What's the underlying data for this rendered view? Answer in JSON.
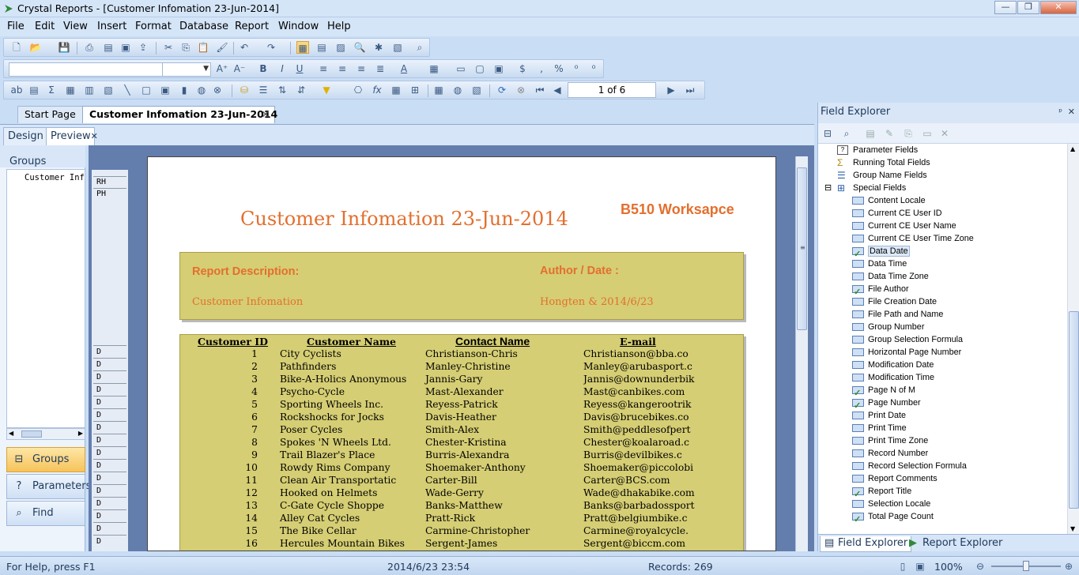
{
  "window": {
    "title": "Crystal Reports - [Customer Infomation 23-Jun-2014]",
    "minimize_label": "—",
    "restore_label": "❐",
    "close_label": "✕"
  },
  "menu": [
    "File",
    "Edit",
    "View",
    "Insert",
    "Format",
    "Database",
    "Report",
    "Window",
    "Help"
  ],
  "navigation": {
    "page_indicator": "1 of 6"
  },
  "document_tabs": {
    "start_page": "Start Page",
    "active": "Customer Infomation 23-Jun-2014",
    "close_glyph": "✕"
  },
  "view_tabs": {
    "design": "Design",
    "preview": "Preview",
    "close_glyph": "✕"
  },
  "left_panel": {
    "groups_header": "Groups",
    "tree_item": "Customer Info",
    "nav_buttons": {
      "groups": "Groups",
      "parameters": "Parameters",
      "find": "Find"
    }
  },
  "sections": {
    "rh": "RH",
    "ph": "PH",
    "detail": "D"
  },
  "report": {
    "title": "Customer Infomation 23-Jun-2014",
    "workspace": "B510 Worksapce",
    "description_label": "Report Description:",
    "author_label": "Author / Date :",
    "description_value": "Customer Infomation",
    "author_value": "Hongten & 2014/6/23",
    "columns": [
      "Customer ID",
      "Customer Name",
      "Contact Name",
      "E-mail"
    ],
    "rows": [
      [
        "1",
        "City Cyclists",
        "Christianson-Chris",
        "Christianson@bba.co"
      ],
      [
        "2",
        "Pathfinders",
        "Manley-Christine",
        "Manley@arubasport.c"
      ],
      [
        "3",
        "Bike-A-Holics Anonymous",
        "Jannis-Gary",
        "Jannis@downunderbik"
      ],
      [
        "4",
        "Psycho-Cycle",
        "Mast-Alexander",
        "Mast@canbikes.com"
      ],
      [
        "5",
        "Sporting Wheels Inc.",
        "Reyess-Patrick",
        "Reyess@kangerootrik"
      ],
      [
        "6",
        "Rockshocks for Jocks",
        "Davis-Heather",
        "Davis@brucebikes.co"
      ],
      [
        "7",
        "Poser Cycles",
        "Smith-Alex",
        "Smith@peddlesofpert"
      ],
      [
        "8",
        "Spokes 'N Wheels Ltd.",
        "Chester-Kristina",
        "Chester@koalaroad.c"
      ],
      [
        "9",
        "Trail Blazer's Place",
        "Burris-Alexandra",
        "Burris@devilbikes.c"
      ],
      [
        "10",
        "Rowdy Rims Company",
        "Shoemaker-Anthony",
        "Shoemaker@piccolobi"
      ],
      [
        "11",
        "Clean Air Transportatic",
        "Carter-Bill",
        "Carter@BCS.com"
      ],
      [
        "12",
        "Hooked on Helmets",
        "Wade-Gerry",
        "Wade@dhakabike.com"
      ],
      [
        "13",
        "C-Gate Cycle Shoppe",
        "Banks-Matthew",
        "Banks@barbadossport"
      ],
      [
        "14",
        "Alley Cat Cycles",
        "Pratt-Rick",
        "Pratt@belgiumbike.c"
      ],
      [
        "15",
        "The Bike Cellar",
        "Carmine-Christopher",
        "Carmine@royalcycle."
      ],
      [
        "16",
        "Hercules Mountain Bikes",
        "Sergent-James",
        "Sergent@biccm.com"
      ]
    ]
  },
  "field_explorer": {
    "title": "Field Explorer",
    "pin_glyph": "ᵖ",
    "close_glyph": "✕",
    "top_items": [
      "Parameter Fields",
      "Running Total Fields",
      "Group Name Fields",
      "Special Fields"
    ],
    "expander": "⊟",
    "special_fields": [
      {
        "label": "Content Locale",
        "checked": false
      },
      {
        "label": "Current CE User ID",
        "checked": false
      },
      {
        "label": "Current CE User Name",
        "checked": false
      },
      {
        "label": "Current CE User Time Zone",
        "checked": false
      },
      {
        "label": "Data Date",
        "checked": true
      },
      {
        "label": "Data Time",
        "checked": false
      },
      {
        "label": "Data Time Zone",
        "checked": false
      },
      {
        "label": "File Author",
        "checked": true
      },
      {
        "label": "File Creation Date",
        "checked": false
      },
      {
        "label": "File Path and Name",
        "checked": false
      },
      {
        "label": "Group Number",
        "checked": false
      },
      {
        "label": "Group Selection Formula",
        "checked": false
      },
      {
        "label": "Horizontal Page Number",
        "checked": false
      },
      {
        "label": "Modification Date",
        "checked": false
      },
      {
        "label": "Modification Time",
        "checked": false
      },
      {
        "label": "Page N of M",
        "checked": true
      },
      {
        "label": "Page Number",
        "checked": true
      },
      {
        "label": "Print Date",
        "checked": false
      },
      {
        "label": "Print Time",
        "checked": false
      },
      {
        "label": "Print Time Zone",
        "checked": false
      },
      {
        "label": "Record Number",
        "checked": false
      },
      {
        "label": "Record Selection Formula",
        "checked": false
      },
      {
        "label": "Report Comments",
        "checked": false
      },
      {
        "label": "Report Title",
        "checked": true
      },
      {
        "label": "Selection Locale",
        "checked": false
      },
      {
        "label": "Total Page Count",
        "checked": true
      }
    ],
    "bottom_tabs": {
      "field_explorer": "Field Explorer",
      "report_explorer": "Report Explorer"
    }
  },
  "statusbar": {
    "help": "For Help, press F1",
    "datetime": "2014/6/23  23:54",
    "records": "Records:  269",
    "zoom": "100%"
  }
}
